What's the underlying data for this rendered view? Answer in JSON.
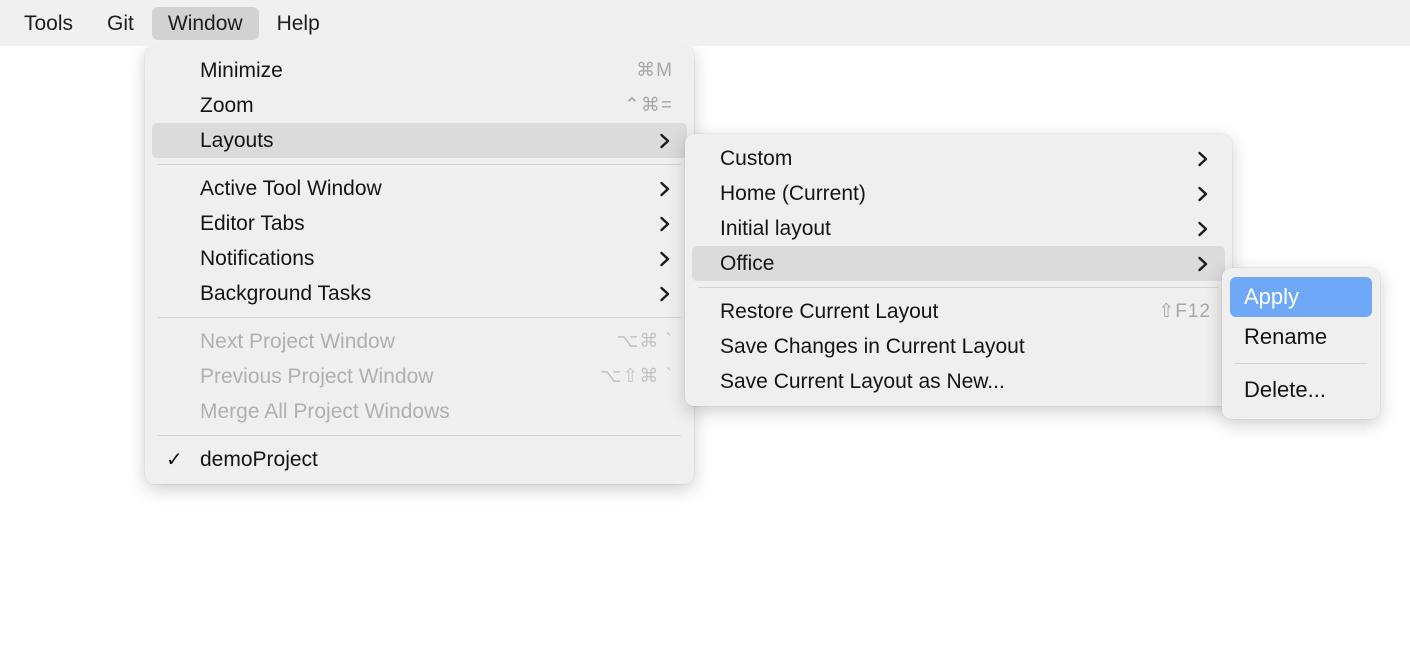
{
  "menubar": {
    "items": [
      {
        "label": "Tools",
        "active": false
      },
      {
        "label": "Git",
        "active": false
      },
      {
        "label": "Window",
        "active": true
      },
      {
        "label": "Help",
        "active": false
      }
    ]
  },
  "window_menu": {
    "items": [
      {
        "label": "Minimize",
        "shortcut": "⌘M",
        "state": "normal",
        "submenu": false
      },
      {
        "label": "Zoom",
        "shortcut": "⌃⌘=",
        "state": "normal",
        "submenu": false
      },
      {
        "label": "Layouts",
        "shortcut": "",
        "state": "highlight",
        "submenu": true
      },
      {
        "separator": true
      },
      {
        "label": "Active Tool Window",
        "shortcut": "",
        "state": "normal",
        "submenu": true
      },
      {
        "label": "Editor Tabs",
        "shortcut": "",
        "state": "normal",
        "submenu": true
      },
      {
        "label": "Notifications",
        "shortcut": "",
        "state": "normal",
        "submenu": true
      },
      {
        "label": "Background Tasks",
        "shortcut": "",
        "state": "normal",
        "submenu": true
      },
      {
        "separator": true
      },
      {
        "label": "Next Project Window",
        "shortcut": "⌥⌘ `",
        "state": "disabled",
        "submenu": false
      },
      {
        "label": "Previous Project Window",
        "shortcut": "⌥⇧⌘ `",
        "state": "disabled",
        "submenu": false
      },
      {
        "label": "Merge All Project Windows",
        "shortcut": "",
        "state": "disabled",
        "submenu": false
      },
      {
        "separator": true
      },
      {
        "label": "demoProject",
        "shortcut": "",
        "state": "normal",
        "submenu": false,
        "checked": true
      }
    ]
  },
  "layouts_menu": {
    "items": [
      {
        "label": "Custom",
        "shortcut": "",
        "state": "normal",
        "submenu": true
      },
      {
        "label": "Home (Current)",
        "shortcut": "",
        "state": "normal",
        "submenu": true
      },
      {
        "label": "Initial layout",
        "shortcut": "",
        "state": "normal",
        "submenu": true
      },
      {
        "label": "Office",
        "shortcut": "",
        "state": "highlight",
        "submenu": true
      },
      {
        "separator": true
      },
      {
        "label": "Restore Current Layout",
        "shortcut": "⇧F12",
        "state": "normal",
        "submenu": false
      },
      {
        "label": "Save Changes in Current Layout",
        "shortcut": "",
        "state": "normal",
        "submenu": false
      },
      {
        "label": "Save Current Layout as New...",
        "shortcut": "",
        "state": "normal",
        "submenu": false
      }
    ]
  },
  "office_menu": {
    "items": [
      {
        "label": "Apply",
        "shortcut": "",
        "state": "selected",
        "submenu": false
      },
      {
        "label": "Rename",
        "shortcut": "",
        "state": "normal",
        "submenu": false
      },
      {
        "separator": true
      },
      {
        "label": "Delete...",
        "shortcut": "",
        "state": "normal",
        "submenu": false
      }
    ]
  },
  "colors": {
    "menu_background": "#f0efef",
    "menubar_background": "#f0f0f0",
    "highlight": "#dcdbdb",
    "selection_blue": "#6ea8f6",
    "text": "#141414",
    "disabled_text": "#b0b0b0",
    "shortcut_text": "#a7a7a7",
    "separator": "#d6d5d5"
  }
}
